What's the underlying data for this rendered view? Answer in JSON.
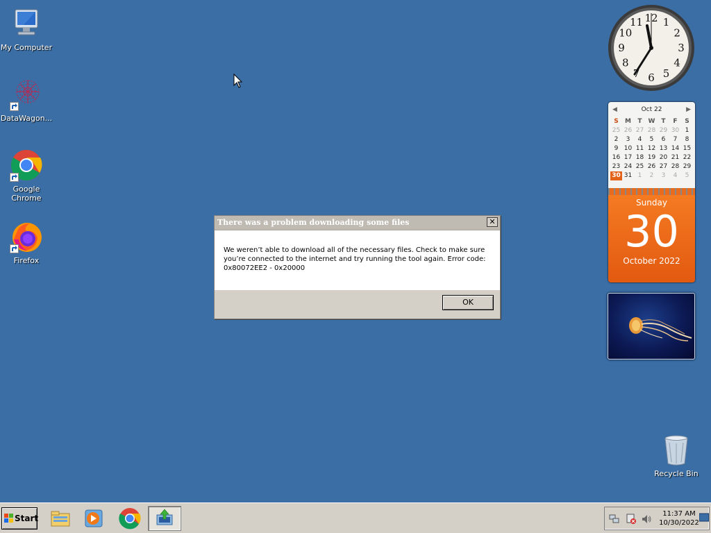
{
  "desktop": {
    "icons": [
      {
        "label": "My Computer",
        "icon": "computer-icon"
      },
      {
        "label": "DataWagon...",
        "icon": "datawagon-icon"
      },
      {
        "label": "Google Chrome",
        "icon": "chrome-icon"
      },
      {
        "label": "Firefox",
        "icon": "firefox-icon"
      },
      {
        "label": "Recycle Bin",
        "icon": "recycle-bin-icon"
      }
    ]
  },
  "dialog": {
    "title": "There was a problem downloading some files",
    "message": "We weren’t able to download all of the necessary files. Check to make sure you’re connected to the internet and try running the tool again. Error code: 0x80072EE2 - 0x20000",
    "ok_label": "OK",
    "close_label": "✕"
  },
  "clock": {
    "numerals": [
      "12",
      "1",
      "2",
      "3",
      "4",
      "5",
      "6",
      "7",
      "8",
      "9",
      "10",
      "11"
    ]
  },
  "calendar": {
    "header": "Oct 22",
    "weekdays": [
      "S",
      "M",
      "T",
      "W",
      "T",
      "F",
      "S"
    ],
    "weeks": [
      [
        "25",
        "26",
        "27",
        "28",
        "29",
        "30",
        "1"
      ],
      [
        "2",
        "3",
        "4",
        "5",
        "6",
        "7",
        "8"
      ],
      [
        "9",
        "10",
        "11",
        "12",
        "13",
        "14",
        "15"
      ],
      [
        "16",
        "17",
        "18",
        "19",
        "20",
        "21",
        "22"
      ],
      [
        "23",
        "24",
        "25",
        "26",
        "27",
        "28",
        "29"
      ],
      [
        "30",
        "31",
        "1",
        "2",
        "3",
        "4",
        "5"
      ]
    ],
    "day_name": "Sunday",
    "day_number": "30",
    "month_year": "October 2022",
    "accent": "#e4631a"
  },
  "taskbar": {
    "start_label": "Start",
    "apps": [
      "explorer-icon",
      "media-player-icon",
      "chrome-icon",
      "installer-icon"
    ],
    "tray": {
      "time": "11:37 AM",
      "date": "10/30/2022"
    }
  },
  "colors": {
    "desktop": "#3a6ea5",
    "taskbar": "#d4d0c8"
  }
}
